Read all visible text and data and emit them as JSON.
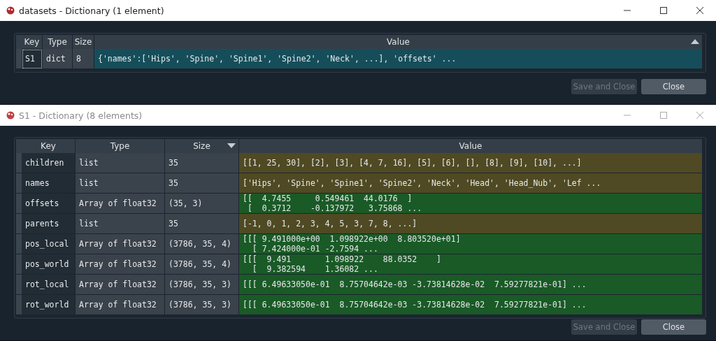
{
  "windows": [
    {
      "title": "datasets - Dictionary (1 element)",
      "active": true,
      "table": {
        "columns": [
          {
            "label": "Key"
          },
          {
            "label": "Type"
          },
          {
            "label": "Size"
          },
          {
            "label": "Value",
            "sorted": true,
            "ascending": true
          }
        ],
        "rows": [
          {
            "key": "S1",
            "type": "dict",
            "size": "8",
            "value": "{'names':['Hips', 'Spine', 'Spine1', 'Spine2', 'Neck', ...], 'offsets' ...",
            "selected": true
          }
        ]
      },
      "buttons": [
        {
          "label": "Save and Close",
          "disabled": true
        },
        {
          "label": "Close",
          "disabled": false
        }
      ]
    },
    {
      "title": "S1 - Dictionary (8 elements)",
      "active": false,
      "table": {
        "columns": [
          {
            "label": "Key"
          },
          {
            "label": "Type"
          },
          {
            "label": "Size",
            "sorted": true,
            "ascending": false
          },
          {
            "label": "Value"
          }
        ],
        "rows": [
          {
            "key": "children",
            "type": "list",
            "size": "35",
            "value": "[[1, 25, 30], [2], [3], [4, 7, 16], [5], [6], [], [8], [9], [10], ...]",
            "selected": false,
            "color": "#4f4a23"
          },
          {
            "key": "names",
            "type": "list",
            "size": "35",
            "value": "['Hips', 'Spine', 'Spine1', 'Spine2', 'Neck', 'Head', 'Head_Nub', 'Lef ...",
            "selected": false,
            "color": "#4f4a23"
          },
          {
            "key": "offsets",
            "type": "Array of float32",
            "size": "(35, 3)",
            "value": "[[  4.7455     0.549461  44.0176  ]\n [  0.3712    -0.137972   3.75868 ...",
            "selected": false,
            "color": "#1a5a27"
          },
          {
            "key": "parents",
            "type": "list",
            "size": "35",
            "value": "[-1, 0, 1, 2, 3, 4, 5, 3, 7, 8, ...]",
            "selected": false,
            "color": "#4f4a23"
          },
          {
            "key": "pos_local",
            "type": "Array of float32",
            "size": "(3786, 35, 4)",
            "value": "[[[ 9.491000e+00  1.098922e+00  8.803520e+01]\n  [ 7.424000e-01 -2.7594 ...",
            "selected": false,
            "color": "#1a5a27"
          },
          {
            "key": "pos_world",
            "type": "Array of float32",
            "size": "(3786, 35, 4)",
            "value": "[[[  9.491       1.098922    88.0352    ]\n  [  9.382594    1.36082 ...",
            "selected": false,
            "color": "#1a5a27"
          },
          {
            "key": "rot_local",
            "type": "Array of float32",
            "size": "(3786, 35, 3)",
            "value": "[[[ 6.49633050e-01  8.75704642e-03 -3.73814628e-02  7.59277821e-01] ...",
            "selected": false,
            "color": "#1a5a27"
          },
          {
            "key": "rot_world",
            "type": "Array of float32",
            "size": "(3786, 35, 3)",
            "value": "[[[ 6.49633050e-01  8.75704642e-03 -3.73814628e-02  7.59277821e-01] ...",
            "selected": false,
            "color": "#1a5a27"
          }
        ]
      },
      "buttons": [
        {
          "label": "Save and Close",
          "disabled": true
        },
        {
          "label": "Close",
          "disabled": false
        }
      ]
    }
  ]
}
